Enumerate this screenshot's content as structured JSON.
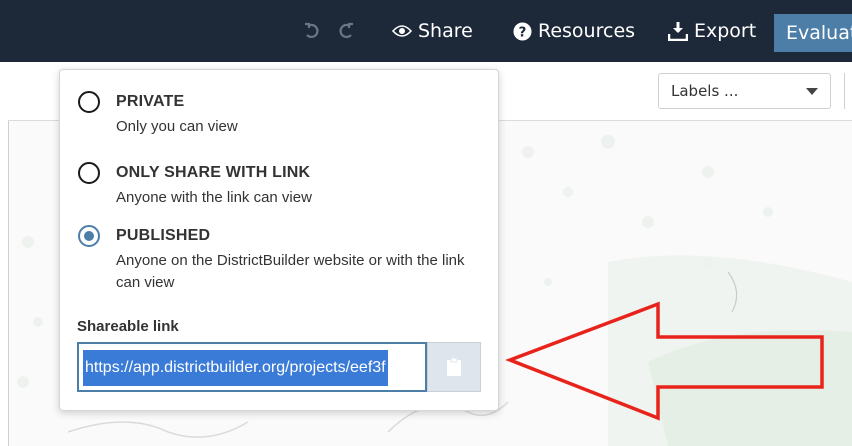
{
  "topbar": {
    "undo_icon": "undo-icon",
    "redo_icon": "redo-icon",
    "share_label": "Share",
    "resources_label": "Resources",
    "export_label": "Export",
    "evaluate_label": "Evaluat"
  },
  "toolbar": {
    "labels_select_value": "Labels ..."
  },
  "share_panel": {
    "options": [
      {
        "title": "PRIVATE",
        "description": "Only you can view",
        "selected": false
      },
      {
        "title": "ONLY SHARE WITH LINK",
        "description": "Anyone with the link can view",
        "selected": false
      },
      {
        "title": "PUBLISHED",
        "description": "Anyone on the DistrictBuilder website or with the link can view",
        "selected": true
      }
    ],
    "shareable_link_label": "Shareable link",
    "shareable_link_value": "https://app.districtbuilder.org/projects/eef3f",
    "copy_icon": "clipboard-icon"
  },
  "colors": {
    "topbar_bg": "#1d2939",
    "accent": "#4d7ea8",
    "selection": "#3b7bd8",
    "annotation_arrow": "#e8231b"
  }
}
